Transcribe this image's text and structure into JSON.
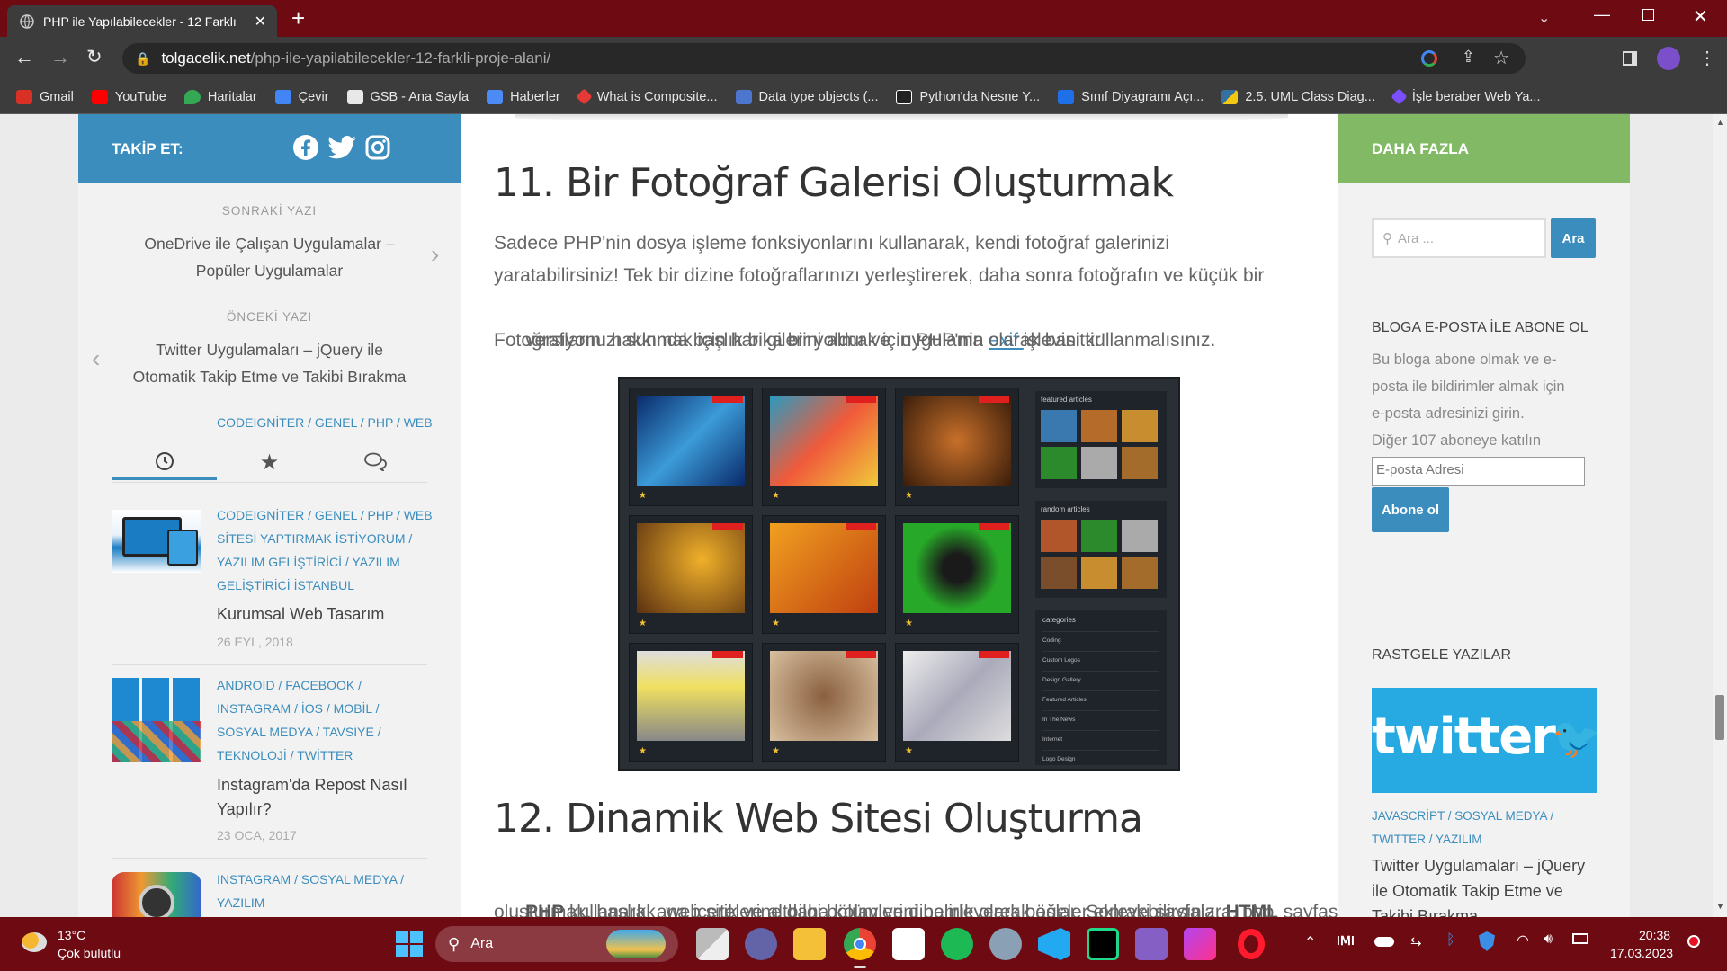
{
  "browser": {
    "tab_title": "PHP ile Yapılabilecekler - 12 Farklı",
    "url_domain": "tolgacelik.net",
    "url_path": "/php-ile-yapilabilecekler-12-farkli-proje-alani/",
    "bookmarks": [
      {
        "label": "Gmail",
        "color": "#d93025"
      },
      {
        "label": "YouTube",
        "color": "#ff0000"
      },
      {
        "label": "Haritalar",
        "color": "#34a853"
      },
      {
        "label": "Çevir",
        "color": "#4285f4"
      },
      {
        "label": "GSB - Ana Sayfa",
        "color": "#e8e8e8"
      },
      {
        "label": "Haberler",
        "color": "#4c8bf5"
      },
      {
        "label": "What is Composite...",
        "color": "#e53935"
      },
      {
        "label": "Data type objects (...",
        "color": "#4d77cf"
      },
      {
        "label": "Python'da Nesne Y...",
        "color": "#222222"
      },
      {
        "label": "Sınıf Diyagramı Açı...",
        "color": "#1e6fe8"
      },
      {
        "label": "2.5. UML Class Diag...",
        "color": "#f2c811"
      },
      {
        "label": "İşle beraber Web Ya...",
        "color": "#7b4fff"
      }
    ]
  },
  "left": {
    "follow_label": "TAKİP ET:",
    "next_label": "SONRAKİ YAZI",
    "next_title_1": "OneDrive ile Çalışan Uygulamalar –",
    "next_title_2": "Popüler Uygulamalar",
    "prev_label": "ÖNCEKİ YAZI",
    "prev_title_1": "Twitter Uygulamaları – jQuery ile",
    "prev_title_2": "Otomatik Takip Etme ve Takibi Bırakma",
    "posts": [
      {
        "cat_lines": [
          "CODEIGNİTER / GENEL / PHP / WEB",
          "SİTESİ YAPTIRMAK İSTİYORUM /",
          "YAZILIM GELİŞTİRİCİ / YAZILIM",
          "GELİŞTİRİCİ İSTANBUL"
        ],
        "title_lines": [
          "Kurumsal Web Tasarım"
        ],
        "date": "26 EYL, 2018"
      },
      {
        "cat_lines": [
          "ANDROID / FACEBOOK /",
          "INSTAGRAM / İOS / MOBİL /",
          "SOSYAL MEDYA / TAVSİYE /",
          "TEKNOLOJİ / TWİTTER"
        ],
        "title_lines": [
          "Instagram'da Repost Nasıl",
          "Yapılır?"
        ],
        "date": "23 OCA, 2017"
      },
      {
        "cat_lines": [
          "INSTAGRAM / SOSYAL MEDYA /",
          "YAZILIM"
        ],
        "title_lines": [],
        "date": ""
      }
    ]
  },
  "main": {
    "heading_11": "11. Bir Fotoğraf Galerisi Oluşturmak",
    "para_11_l1": "Sadece PHP'nin dosya işleme fonksiyonlarını kullanarak, kendi fotoğraf galerinizi",
    "para_11_l2": "yaratabilirsiniz! Tek bir dizine fotoğraflarınızı yerleştirerek, daha sonra fotoğrafın ve küçük bir",
    "para_11_l3a": "versiyonu hakkında başlık bilgilerini almak için PHP'nin ",
    "para_11_link": "exif ",
    "para_11_l3b": "işlevini kullanmalısınız.",
    "para_11_l4": "Fotoğraflarınızı sunmak için harika bir yoldur ve  uygulama olarak basittir!",
    "gallery": {
      "featured_label": "featured articles",
      "random_label": "random articles",
      "categories_label": "categories",
      "categories": [
        "Coding",
        "Custom Logos",
        "Design Gallery",
        "Featured Articles",
        "In The News",
        "Internet",
        "Logo Design"
      ]
    },
    "heading_12": "12. Dinamik Web Sitesi Oluşturma",
    "para_12_b1": "PHP",
    "para_12_t1": " kullanarak, web sitelerine daha kolay ve dinamik olarak öğeler ekleyebilirsiniz. ",
    "para_12_b2": "HTML",
    "para_12_t2": " sayfası",
    "para_12_l2": "oluşturmak, başlık, ana içerik ve altbilgi bölümlerini belirleyerek başlar. Sonraki sayfalara, php"
  },
  "right": {
    "more_label": "DAHA FAZLA",
    "search_placeholder": "Ara ...",
    "search_button": "Ara",
    "subscribe_heading": "BLOGA E-POSTA İLE ABONE OL",
    "subscribe_l1": "Bu bloga abone olmak ve e-",
    "subscribe_l2": "posta ile bildirimler almak için",
    "subscribe_l3": "e-posta adresinizi girin.",
    "subscribe_l4": "Diğer 107 aboneye katılın",
    "email_placeholder": "E-posta Adresi",
    "subscribe_button": "Abone ol",
    "random_heading": "RASTGELE YAZILAR",
    "twitter_logo": "twitter",
    "random_cats_1": "JAVASCRİPT / SOSYAL MEDYA /",
    "random_cats_2": "TWİTTER / YAZILIM",
    "random_title_1": "Twitter Uygulamaları – jQuery",
    "random_title_2": "ile Otomatik Takip Etme ve",
    "random_title_3": "Takibi Bırakma"
  },
  "taskbar": {
    "weather_temp": "13°C",
    "weather_desc": "Çok bulutlu",
    "search_label": "Ara",
    "time": "20:38",
    "date": "17.03.2023"
  }
}
